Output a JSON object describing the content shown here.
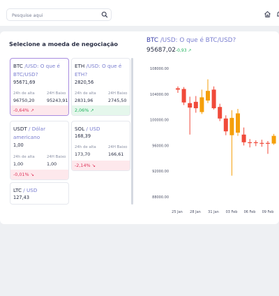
{
  "header": {
    "search_placeholder": "Pesquise aqui",
    "icons": [
      "search-icon",
      "home-icon",
      "bell-icon"
    ]
  },
  "panel": {
    "title": "Selecione a moeda de negociação"
  },
  "labels": {
    "high": "24h de alta",
    "low": "24H Baixo"
  },
  "cards": [
    {
      "symbol": "BTC",
      "subtitle": " /USD: O que é BTC/USD?",
      "price": "95671,69",
      "high": "96750,20",
      "low": "95243,91",
      "change": "-0,64%",
      "dir": "down",
      "selected": true
    },
    {
      "symbol": "ETH",
      "subtitle": " /USD: O que é ETH?",
      "price": "2820,56",
      "high": "2831,96",
      "low": "2745,50",
      "change": "2,06%",
      "dir": "up",
      "selected": false
    },
    {
      "symbol": "USDT",
      "subtitle": " / Dólar americano",
      "price": "1,00",
      "high": "1,00",
      "low": "1,00",
      "change": "-0,01%",
      "dir": "down",
      "selected": false
    },
    {
      "symbol": "SOL",
      "subtitle": " / USD",
      "price": "168,39",
      "high": "173,70",
      "low": "166,61",
      "change": "-2,14%",
      "dir": "down",
      "selected": false
    },
    {
      "symbol": "LTC",
      "subtitle": " / USD",
      "price": "127,43",
      "selected": false
    }
  ],
  "chart_header": {
    "symbol": "BTC",
    "subtitle": " /USD: O que é BTC/USD?",
    "price": "95687,02",
    "change": "-0,93",
    "change_color": "#22b35e"
  },
  "colors": {
    "up": "#f59f0a",
    "down": "#f04a3a",
    "accent": "#a98de0"
  },
  "chart_data": {
    "type": "candlestick",
    "x_ticks": [
      "25 Jan",
      "28 Jan",
      "31 Jan",
      "03 Feb",
      "06 Feb",
      "09 Feb"
    ],
    "y_ticks": [
      "108000.00",
      "104000.00",
      "100000.00",
      "96000.00",
      "92000.00",
      "88000.00"
    ],
    "ylim": [
      88000,
      108000
    ],
    "candles": [
      {
        "o": 104700,
        "h": 105200,
        "l": 104200,
        "c": 104900,
        "dir": "down"
      },
      {
        "o": 104800,
        "h": 105100,
        "l": 102300,
        "c": 102700,
        "dir": "down"
      },
      {
        "o": 102600,
        "h": 103600,
        "l": 97700,
        "c": 101900,
        "dir": "down"
      },
      {
        "o": 101800,
        "h": 103700,
        "l": 101100,
        "c": 102800,
        "dir": "down"
      },
      {
        "o": 101200,
        "h": 104700,
        "l": 100900,
        "c": 103500,
        "dir": "up"
      },
      {
        "o": 103000,
        "h": 106300,
        "l": 102600,
        "c": 104500,
        "dir": "up"
      },
      {
        "o": 104700,
        "h": 105200,
        "l": 101600,
        "c": 101800,
        "dir": "down"
      },
      {
        "o": 102000,
        "h": 102500,
        "l": 99800,
        "c": 100200,
        "dir": "down"
      },
      {
        "o": 100200,
        "h": 100700,
        "l": 97600,
        "c": 98200,
        "dir": "down"
      },
      {
        "o": 97600,
        "h": 101500,
        "l": 91300,
        "c": 100300,
        "dir": "up"
      },
      {
        "o": 98000,
        "h": 101700,
        "l": 97500,
        "c": 101000,
        "dir": "up"
      },
      {
        "o": 97700,
        "h": 98800,
        "l": 96000,
        "c": 96500,
        "dir": "down"
      },
      {
        "o": 96500,
        "h": 97000,
        "l": 95700,
        "c": 96400,
        "dir": "down"
      },
      {
        "o": 96400,
        "h": 96800,
        "l": 95900,
        "c": 96500,
        "dir": "down"
      },
      {
        "o": 96400,
        "h": 96900,
        "l": 95800,
        "c": 96300,
        "dir": "down"
      },
      {
        "o": 96300,
        "h": 96700,
        "l": 94700,
        "c": 96400,
        "dir": "down"
      },
      {
        "o": 96300,
        "h": 97800,
        "l": 96100,
        "c": 97500,
        "dir": "up"
      }
    ]
  }
}
